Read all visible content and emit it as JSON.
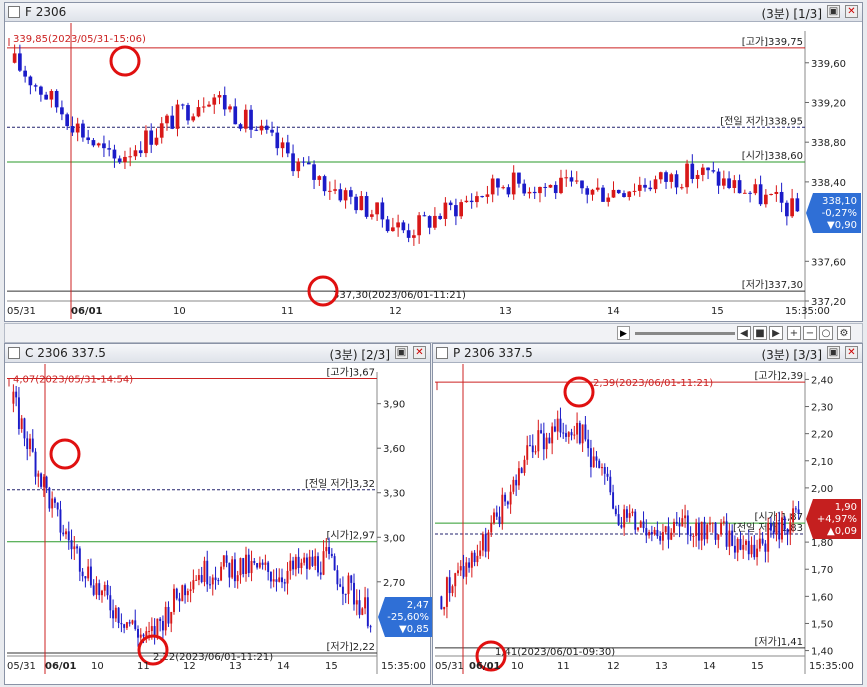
{
  "colors": {
    "up": "#d81818",
    "down": "#1b1bc8",
    "high": "#cc2222",
    "open": "#2a9a2a",
    "prev": "#22226e",
    "low": "#333",
    "badge_up": "#c51f1f",
    "badge_down": "#2f6fd6",
    "circle": "#e01010"
  },
  "charts": [
    {
      "id": "futures",
      "title": "F 2306",
      "header_right": "(3분) [1/3]",
      "y_ticks": [
        "339,60",
        "339,20",
        "338,80",
        "338,40",
        "337,60",
        "337,20"
      ],
      "high_text": "339,85(2023/05/31-15:06)",
      "low_text": "337,30(2023/06/01-11:21)",
      "ref_labels": [
        {
          "text": "[고가]339,75",
          "kind": "high"
        },
        {
          "text": "[전일 저가]338,95",
          "kind": "prev"
        },
        {
          "text": "[시가]338,60",
          "kind": "open"
        },
        {
          "text": "[저가]337,30",
          "kind": "low"
        }
      ],
      "badge": [
        "338,10",
        "-0,27%",
        "▼0,90"
      ],
      "x_labels": [
        "05/31",
        "06/01",
        "10",
        "11",
        "12",
        "13",
        "14",
        "15",
        "15:35:00"
      ]
    },
    {
      "id": "call",
      "title": "C 2306 337.5",
      "header_right": "(3분) [2/3]",
      "y_ticks": [
        "3,90",
        "3,60",
        "3,30",
        "3,00",
        "2,70"
      ],
      "high_text": "4,07(2023/05/31-14:54)",
      "low_text": "2,22(2023/06/01-11:21)",
      "ref_labels": [
        {
          "text": "[고가]3,67",
          "kind": "high"
        },
        {
          "text": "[전일 저가]3,32",
          "kind": "prev"
        },
        {
          "text": "[시가]2,97",
          "kind": "open"
        },
        {
          "text": "[저가]2,22",
          "kind": "low"
        }
      ],
      "badge": [
        "2,47",
        "-25,60%",
        "▼0,85"
      ],
      "x_labels": [
        "05/31",
        "06/01",
        "10",
        "11",
        "12",
        "13",
        "14",
        "15",
        "15:35:00"
      ]
    },
    {
      "id": "put",
      "title": "P 2306 337.5",
      "header_right": "(3분) [3/3]",
      "y_ticks": [
        "2,40",
        "2,30",
        "2,20",
        "2,10",
        "2,00",
        "1,80",
        "1,70",
        "1,60",
        "1,50",
        "1,40"
      ],
      "high_text": "2,39(2023/06/01-11:21)",
      "low_text": "1,41(2023/06/01-09:30)",
      "ref_labels": [
        {
          "text": "[고가]2,39",
          "kind": "high"
        },
        {
          "text": "[시가]1,87",
          "kind": "open"
        },
        {
          "text": "[전일 저가]1,83",
          "kind": "prev"
        },
        {
          "text": "[저가]1,41",
          "kind": "low"
        }
      ],
      "badge": [
        "1,90",
        "+4,97%",
        "▲0,09"
      ],
      "x_labels": [
        "05/31",
        "06/01",
        "10",
        "11",
        "12",
        "13",
        "14",
        "15",
        "15:35:00"
      ]
    }
  ],
  "chart_data": [
    {
      "type": "line",
      "title": "F 2306",
      "ylim": [
        337.2,
        339.9
      ],
      "x": [
        "05/31",
        "06/01",
        "10",
        "11",
        "12",
        "13",
        "14",
        "15",
        "15:35"
      ],
      "y": [
        339.6,
        338.6,
        339.3,
        338.5,
        337.9,
        338.4,
        338.3,
        338.5,
        338.1
      ],
      "high": 339.85,
      "low": 337.3,
      "open": 338.6,
      "prev_low": 338.95
    },
    {
      "type": "line",
      "title": "C 2306 337.5",
      "ylim": [
        2.2,
        4.1
      ],
      "x": [
        "05/31",
        "06/01",
        "10",
        "11",
        "12",
        "13",
        "14",
        "15",
        "15:35"
      ],
      "y": [
        3.9,
        3.1,
        2.6,
        2.3,
        2.75,
        2.8,
        2.75,
        2.85,
        2.47
      ],
      "high": 4.07,
      "low": 2.22,
      "open": 2.97,
      "prev_low": 3.32
    },
    {
      "type": "line",
      "title": "P 2306 337.5",
      "ylim": [
        1.38,
        2.42
      ],
      "x": [
        "05/31",
        "06/01",
        "10",
        "11",
        "12",
        "13",
        "14",
        "15",
        "15:35"
      ],
      "y": [
        1.6,
        1.8,
        2.15,
        2.25,
        1.9,
        1.85,
        1.85,
        1.78,
        1.9
      ],
      "high": 2.39,
      "low": 1.41,
      "open": 1.87,
      "prev_low": 1.83
    }
  ]
}
